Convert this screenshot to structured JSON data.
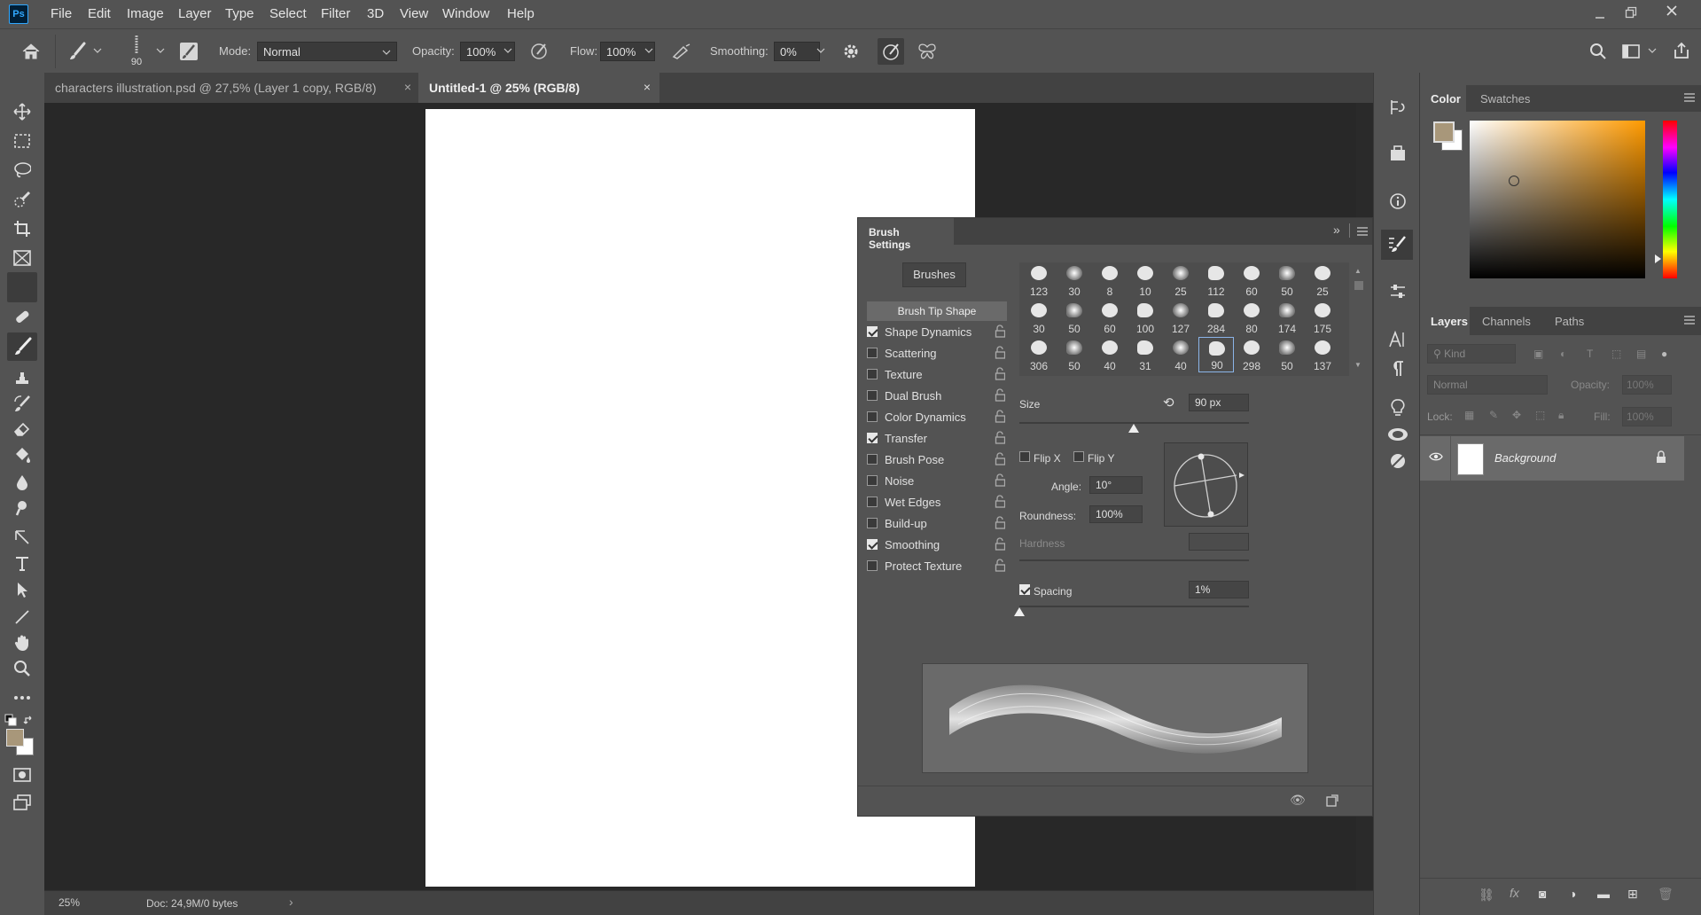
{
  "menubar": {
    "logo": "Ps",
    "items": [
      "File",
      "Edit",
      "Image",
      "Layer",
      "Type",
      "Select",
      "Filter",
      "3D",
      "View",
      "Window",
      "Help"
    ]
  },
  "options": {
    "brush_size": "90",
    "mode_label": "Mode:",
    "mode_value": "Normal",
    "opacity_label": "Opacity:",
    "opacity_value": "100%",
    "flow_label": "Flow:",
    "flow_value": "100%",
    "smoothing_label": "Smoothing:",
    "smoothing_value": "0%"
  },
  "tabs": [
    {
      "label": "characters illustration.psd @ 27,5% (Layer 1 copy, RGB/8)",
      "active": false
    },
    {
      "label": "Untitled-1 @ 25% (RGB/8)",
      "active": true
    }
  ],
  "status": {
    "zoom": "25%",
    "doc": "Doc: 24,9M/0 bytes"
  },
  "brush_settings": {
    "title": "Brush Settings",
    "brushes_button": "Brushes",
    "tip_shape_header": "Brush Tip Shape",
    "options": [
      {
        "label": "Shape Dynamics",
        "checked": true
      },
      {
        "label": "Scattering",
        "checked": false
      },
      {
        "label": "Texture",
        "checked": false
      },
      {
        "label": "Dual Brush",
        "checked": false
      },
      {
        "label": "Color Dynamics",
        "checked": false
      },
      {
        "label": "Transfer",
        "checked": true
      },
      {
        "label": "Brush Pose",
        "checked": false
      },
      {
        "label": "Noise",
        "checked": false
      },
      {
        "label": "Wet Edges",
        "checked": false
      },
      {
        "label": "Build-up",
        "checked": false
      },
      {
        "label": "Smoothing",
        "checked": true
      },
      {
        "label": "Protect Texture",
        "checked": false
      }
    ],
    "tips_row1": [
      "123",
      "30",
      "8",
      "10",
      "25",
      "112",
      "60",
      "50",
      "25"
    ],
    "tips_row2": [
      "30",
      "50",
      "60",
      "100",
      "127",
      "284",
      "80",
      "174",
      "175"
    ],
    "tips_row3": [
      "306",
      "50",
      "40",
      "31",
      "40",
      "90",
      "298",
      "50",
      "137"
    ],
    "size_label": "Size",
    "size_value": "90 px",
    "flip_x": "Flip X",
    "flip_y": "Flip Y",
    "angle_label": "Angle:",
    "angle_value": "10°",
    "roundness_label": "Roundness:",
    "roundness_value": "100%",
    "hardness_label": "Hardness",
    "spacing_label": "Spacing",
    "spacing_value": "1%"
  },
  "color_panel": {
    "tab_color": "Color",
    "tab_swatches": "Swatches",
    "foreground": "#a8977a",
    "background": "#ffffff"
  },
  "layers_panel": {
    "tab_layers": "Layers",
    "tab_channels": "Channels",
    "tab_paths": "Paths",
    "kind_placeholder": "Kind",
    "blend_mode": "Normal",
    "opacity_label": "Opacity:",
    "opacity_value": "100%",
    "lock_label": "Lock:",
    "fill_label": "Fill:",
    "fill_value": "100%",
    "layers": [
      {
        "name": "Background"
      }
    ]
  }
}
